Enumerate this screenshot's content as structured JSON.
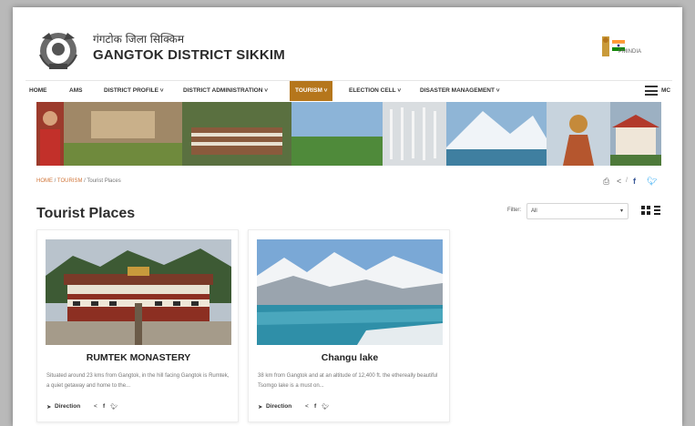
{
  "header": {
    "hindi_title": "गंगटोक जिला सिक्किम",
    "site_title": "GANGTOK DISTRICT SIKKIM",
    "pmindia_label": "PMINDIA"
  },
  "nav": {
    "items": [
      {
        "label": "HOME"
      },
      {
        "label": "AMS"
      },
      {
        "label": "DISTRICT PROFILE ˅"
      },
      {
        "label": "DISTRICT ADMINISTRATION ˅"
      },
      {
        "label": "TOURISM ˅"
      },
      {
        "label": "ELECTION CELL ˅"
      },
      {
        "label": "DISASTER MANAGEMENT ˅"
      }
    ],
    "active_index": 4,
    "menu_label": "MC"
  },
  "breadcrumb": {
    "home": "HOME",
    "sep": " / ",
    "tourism": "TOURISM",
    "current": "Tourist Places"
  },
  "page": {
    "title": "Tourist Places"
  },
  "filter": {
    "label": "Filter:",
    "value": "All"
  },
  "share": {
    "print_icon": "print-icon",
    "share_icon": "share-icon",
    "facebook_icon": "facebook-icon",
    "twitter_icon": "twitter-icon"
  },
  "cards": [
    {
      "title": "RUMTEK MONASTERY",
      "desc": "Situated around 23 kms from Gangtok, in the hill facing Gangtok is Rumtek, a quiet getaway and home to the...",
      "direction": "Direction"
    },
    {
      "title": "Changu lake",
      "desc": "38 km from Gangtok and at an altitude of 12,400 ft. the ethereally beautiful Tsomgo lake is a must on...",
      "direction": "Direction"
    }
  ],
  "colors": {
    "accent": "#b5761c",
    "breadcrumb_link": "#d0763a",
    "facebook": "#3b5998",
    "twitter": "#1da1f2"
  }
}
